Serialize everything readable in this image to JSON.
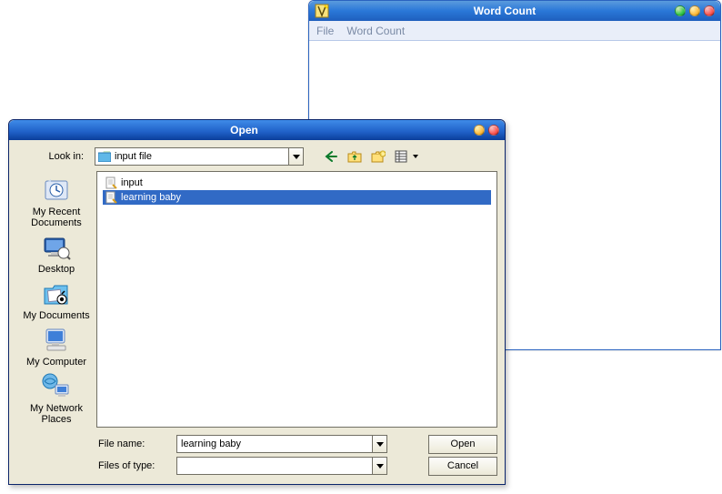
{
  "wordcount": {
    "title": "Word Count",
    "menu": {
      "file": "File",
      "wordcount": "Word Count"
    }
  },
  "open": {
    "title": "Open",
    "lookin_label": "Look in:",
    "lookin_value": "input file",
    "places": {
      "recent": "My Recent Documents",
      "desktop": "Desktop",
      "mydocs": "My Documents",
      "mycomp": "My Computer",
      "network": "My Network Places"
    },
    "files": {
      "0": {
        "name": "input"
      },
      "1": {
        "name": "learning baby"
      }
    },
    "selected_index": 1,
    "filename_label": "File name:",
    "filename_value": "learning baby",
    "filetype_label": "Files of type:",
    "filetype_value": "",
    "open_btn": "Open",
    "cancel_btn": "Cancel"
  }
}
